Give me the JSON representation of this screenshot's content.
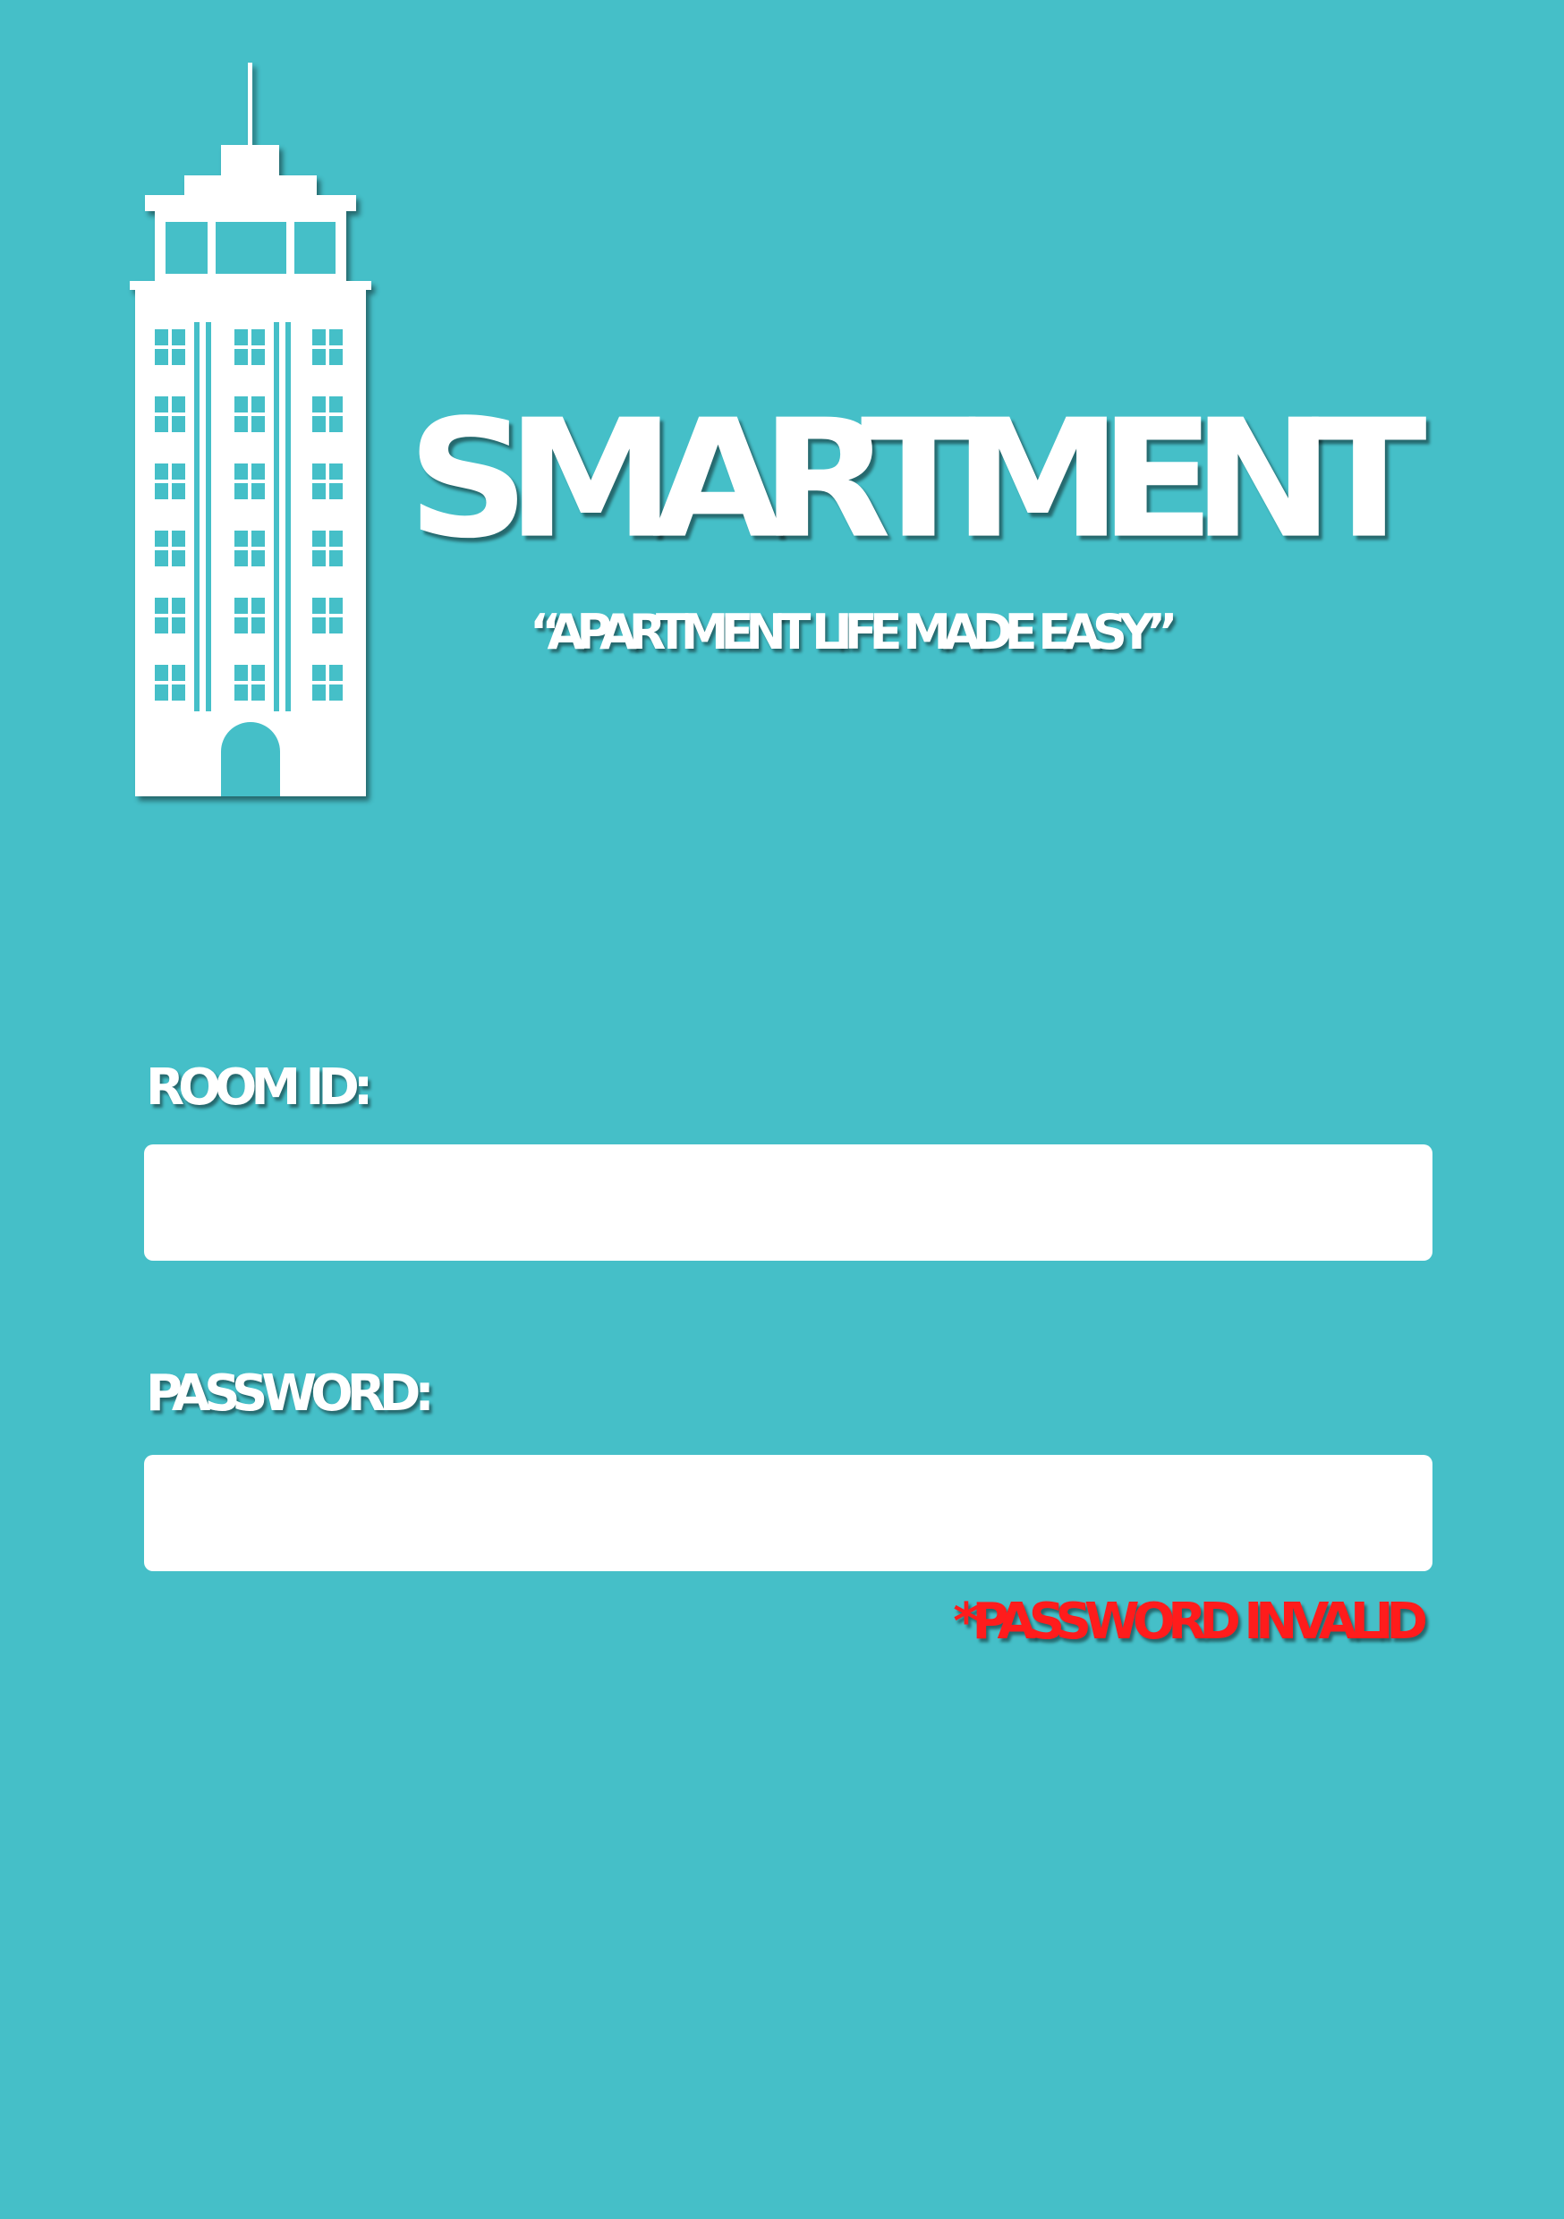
{
  "brand": {
    "name": "SMARTMENT",
    "tagline": "“APARTMENT LIFE MADE EASY”",
    "logo_icon": "apartment-building-icon"
  },
  "form": {
    "room_id": {
      "label": "ROOM ID:",
      "value": ""
    },
    "password": {
      "label": "PASSWORD:",
      "value": ""
    },
    "error": "*PASSWORD INVALID"
  },
  "colors": {
    "background": "#45bfc8",
    "foreground": "#ffffff",
    "error": "#ff1c1c"
  }
}
